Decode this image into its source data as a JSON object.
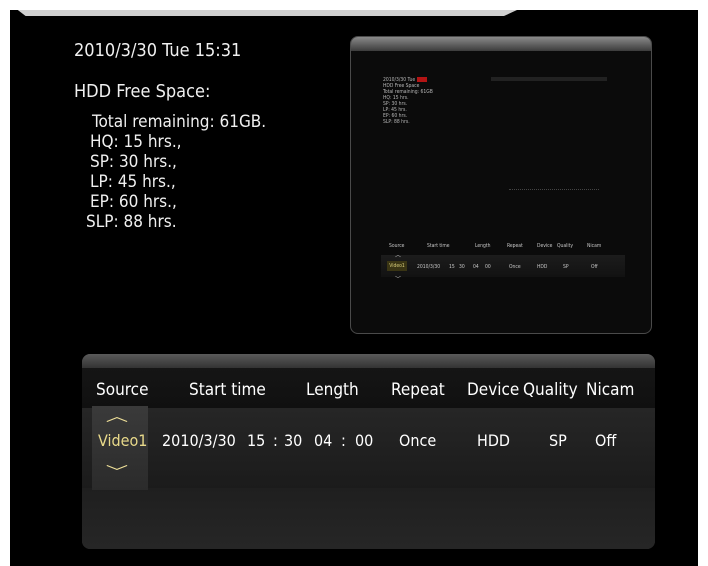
{
  "status": {
    "datetime": "2010/3/30 Tue 15:31",
    "hdd_label": "HDD Free Space:",
    "total_remaining": "Total remaining: 61GB.",
    "hq": "HQ: 15 hrs.,",
    "sp": "SP: 30 hrs.,",
    "lp": "LP: 45 hrs.,",
    "ep": "EP: 60 hrs.,",
    "slp": "SLP: 88 hrs."
  },
  "preview": {
    "datetime": "2010/3/30 Tue",
    "hdd_label": "HDD Free Space",
    "total_remaining": "Total remaining: 61GB",
    "hq": "HQ: 15 hrs.",
    "sp": "SP: 30 hrs.",
    "lp": "LP: 45 hrs.",
    "ep": "EP: 60 hrs.",
    "slp": "SLP: 88 hrs.",
    "headers": [
      "Source",
      "Start time",
      "Length",
      "Repeat",
      "Device",
      "Quality",
      "Nicam"
    ],
    "source": "Video1",
    "date": "2010/3/30",
    "hour": "15",
    "minute": "30",
    "len_h": "04",
    "len_m": "00",
    "repeat": "Once",
    "device": "HDD",
    "quality": "SP",
    "nicam": "Off"
  },
  "schedule": {
    "headers": {
      "source": "Source",
      "start_time": "Start time",
      "length": "Length",
      "repeat": "Repeat",
      "device": "Device",
      "quality": "Quality",
      "nicam": "Nicam"
    },
    "row": {
      "source": "Video1",
      "date": "2010/3/30",
      "hour": "15",
      "sep1": ":",
      "minute": "30",
      "len_hours": "04",
      "sep2": ":",
      "len_minutes": "00",
      "repeat": "Once",
      "device": "HDD",
      "quality": "SP",
      "nicam": "Off"
    }
  },
  "icons": {
    "source_up": "chevron-up-icon",
    "source_down": "chevron-down-icon"
  },
  "colors": {
    "background": "#000000",
    "selected_text": "#e8d98a"
  }
}
